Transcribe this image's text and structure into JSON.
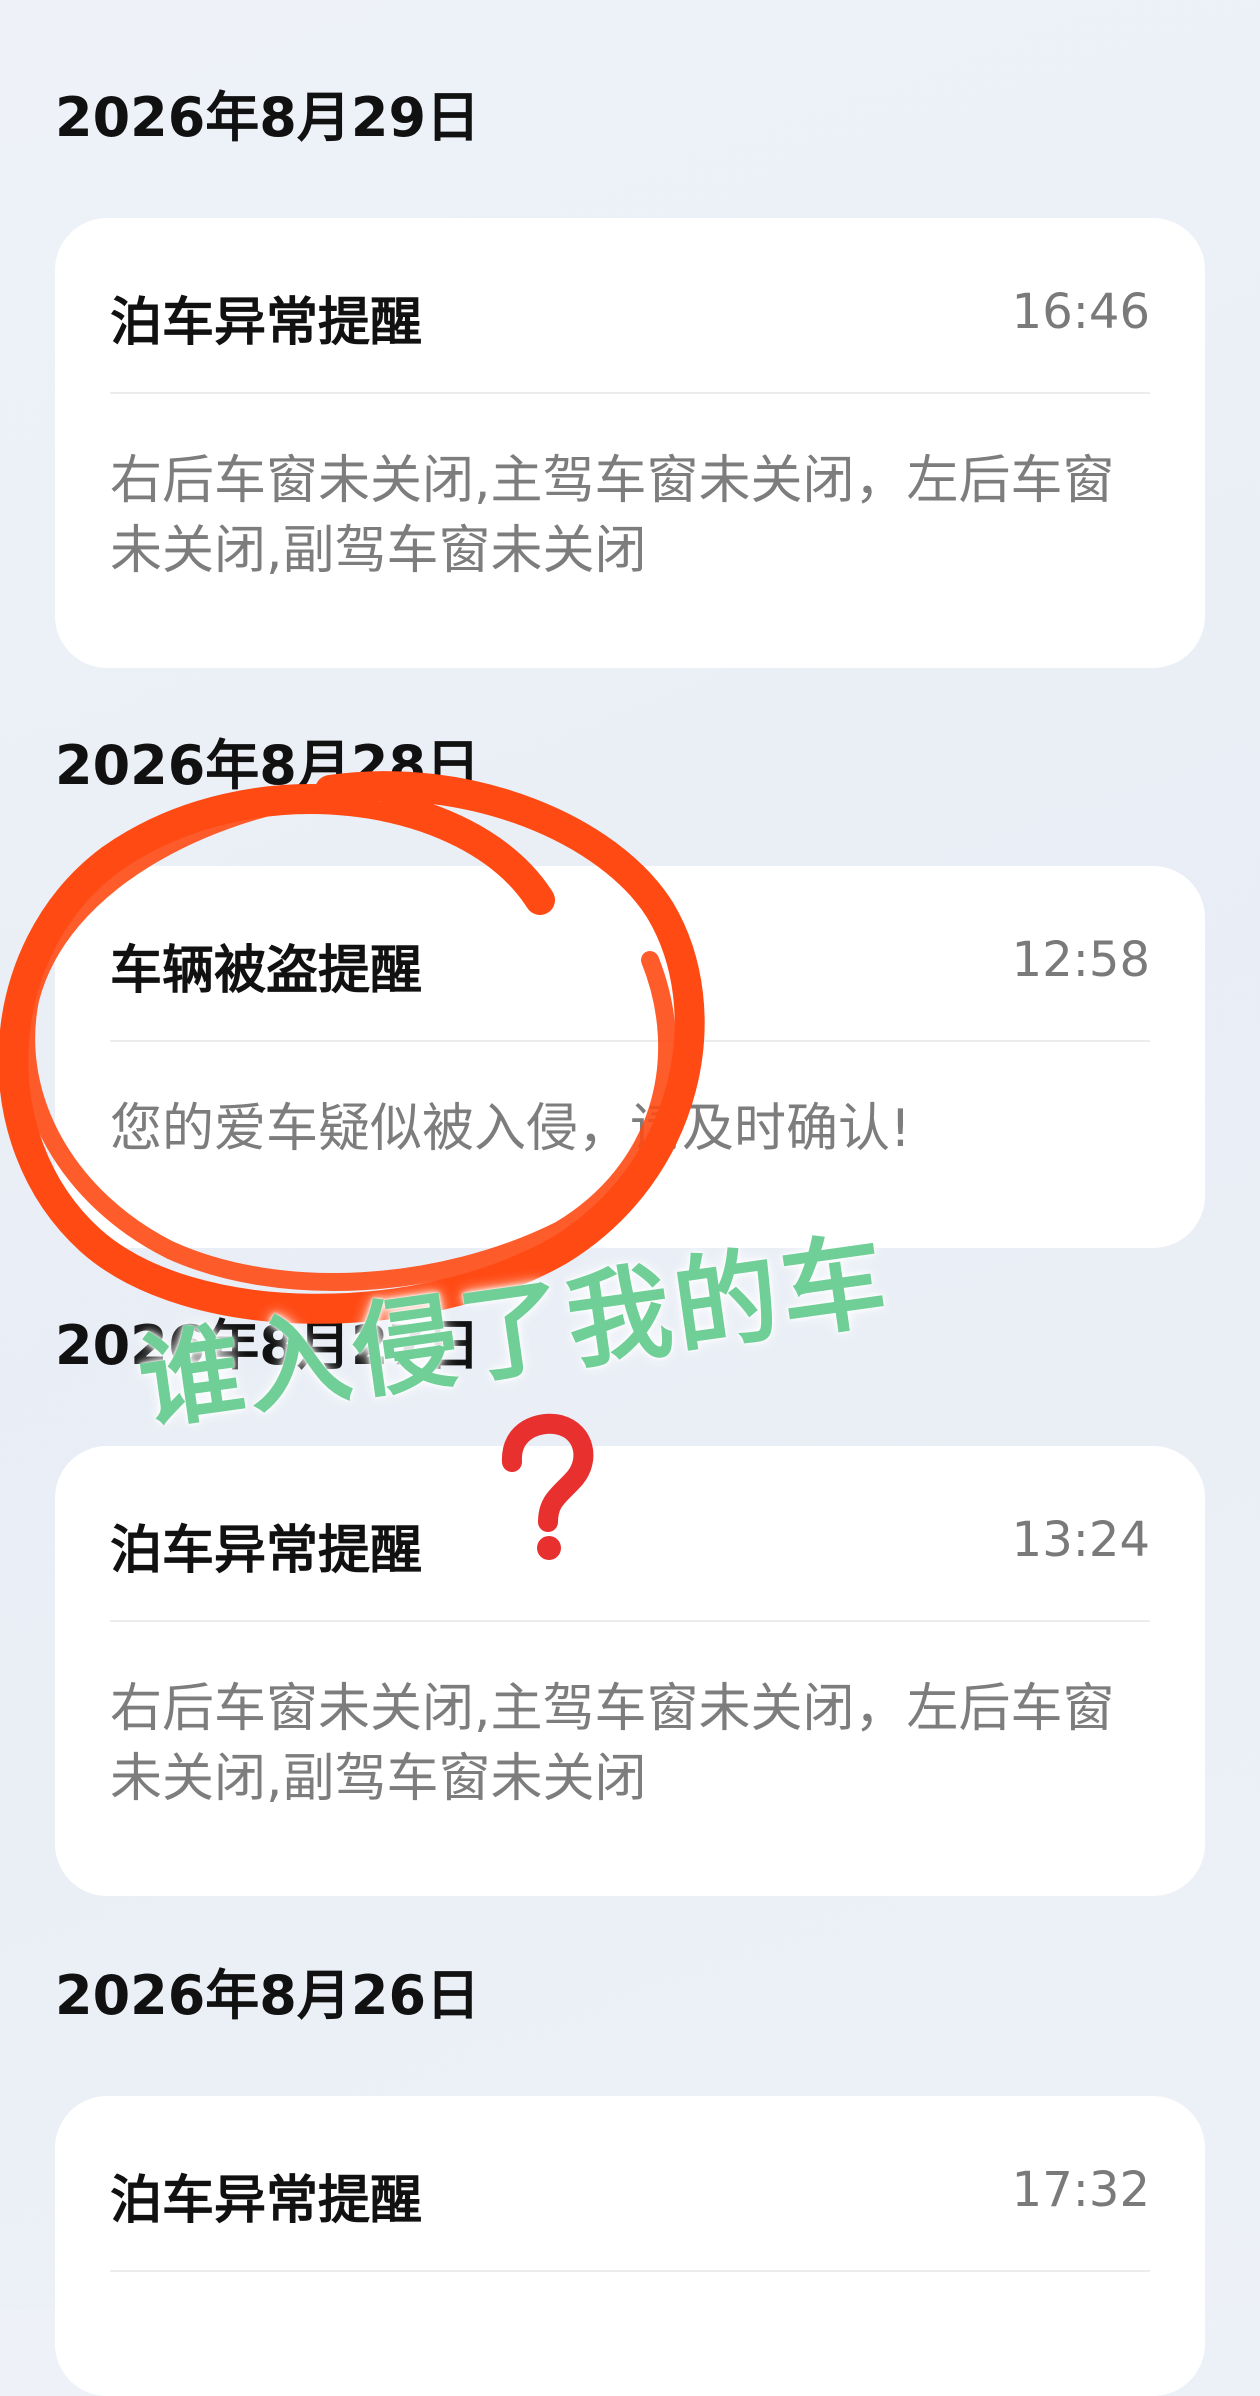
{
  "groups": [
    {
      "date": "2026年8月29日",
      "title": "泊车异常提醒",
      "time": "16:46",
      "message": "右后车窗未关闭,主驾车窗未关闭，左后车窗未关闭,副驾车窗未关闭"
    },
    {
      "date": "2026年8月28日",
      "title": "车辆被盗提醒",
      "time": "12:58",
      "message": "您的爱车疑似被入侵，请及时确认!"
    },
    {
      "date": "2026年8月27日",
      "title": "泊车异常提醒",
      "time": "13:24",
      "message": "右后车窗未关闭,主驾车窗未关闭，左后车窗未关闭,副驾车窗未关闭"
    },
    {
      "date": "2026年8月26日",
      "title": "泊车异常提醒",
      "time": "17:32",
      "message": ""
    }
  ],
  "annotation": {
    "text": "谁入侵了我的车",
    "circle_color": "#ff4a14",
    "text_color": "#6fcf97",
    "question_mark_color": "#e8302e",
    "question_icon": "red-question-mark-icon"
  }
}
